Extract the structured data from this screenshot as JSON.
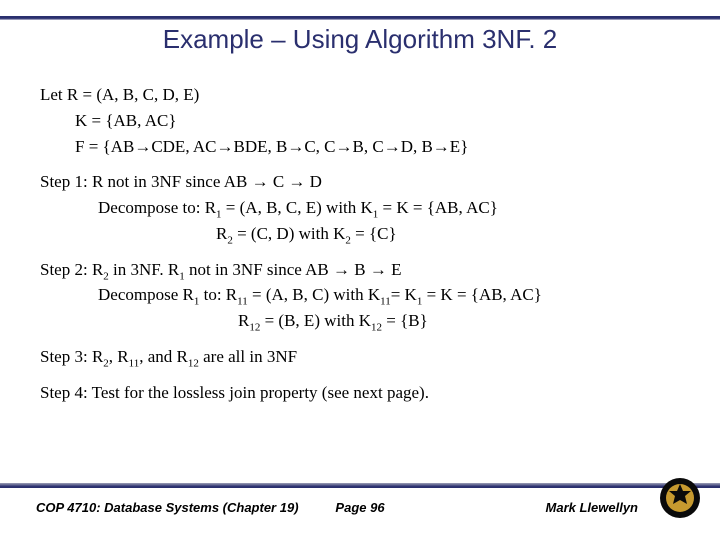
{
  "title": "Example – Using Algorithm 3NF. 2",
  "let": {
    "r": "Let R = (A, B, C, D, E)",
    "k": "K = {AB, AC}",
    "f": "F = {AB→CDE, AC→BDE, B→C, C→B, C→D, B→E}"
  },
  "step1": {
    "line1": "Step 1: R not in 3NF since AB → C → D",
    "line2_pre": "Decompose to:  R",
    "line2_post": " = (A, B, C, E) with K",
    "line2_end": " = K = {AB, AC}",
    "line3_pre": "R",
    "line3_mid": " = (C, D) with K",
    "line3_end": " = {C}"
  },
  "step2": {
    "line1_pre": "Step 2: R",
    "line1_mid": " in 3NF.   R",
    "line1_end": " not in 3NF since AB → B → E",
    "line2_pre": "Decompose R",
    "line2_mid": " to:  R",
    "line2_mid2": " = (A, B, C) with K",
    "line2_mid3": "= K",
    "line2_end": " = K = {AB, AC}",
    "line3_pre": "R",
    "line3_mid": " = (B, E) with K",
    "line3_end": " = {B}"
  },
  "step3": {
    "pre": "Step 3: R",
    "mid1": ", R",
    "mid2": ", and R",
    "end": " are all in 3NF"
  },
  "step4": "Step 4: Test for the lossless join property (see next page).",
  "footer": {
    "left": "COP 4710: Database Systems  (Chapter 19)",
    "center": "Page 96",
    "right": "Mark Llewellyn"
  },
  "subs": {
    "one": "1",
    "two": "2",
    "eleven": "11",
    "twelve": "12"
  }
}
